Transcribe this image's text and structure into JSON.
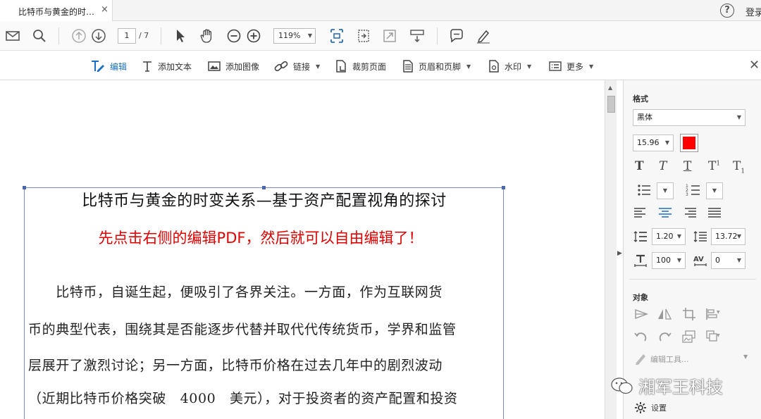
{
  "tab": {
    "title": "比特币与黄金的时…",
    "close": "×"
  },
  "header": {
    "help": "?",
    "login": "登录"
  },
  "toolbar": {
    "page_current": "1",
    "page_total": "/ 7",
    "zoom": "119%"
  },
  "edit_toolbar": {
    "items": [
      {
        "label": "编辑",
        "active": true
      },
      {
        "label": "添加文本"
      },
      {
        "label": "添加图像"
      },
      {
        "label": "链接"
      },
      {
        "label": "裁剪页面"
      },
      {
        "label": "页眉和页脚"
      },
      {
        "label": "水印"
      },
      {
        "label": "更多"
      }
    ],
    "close": "✕"
  },
  "document": {
    "title": "比特币与黄金的时变关系—基于资产配置视角的探讨",
    "instruction": "先点击右侧的编辑PDF，然后就可以自由编辑了！",
    "lines": [
      "　　比特币，自诞生起，便吸引了各界关注。一方面，作为互联网货",
      "币的典型代表，围绕其是否能逐步代替并取代代传统货币，学界和监管",
      "层展开了激烈讨论；另一方面，比特币价格在过去几年中的剧烈波动",
      "（近期比特币价格突破　4000　美元），对于投资者的资产配置和投资"
    ]
  },
  "panel": {
    "format_heading": "格式",
    "font_family": "黑体",
    "font_size": "15.96",
    "font_color": "#ff0000",
    "line_spacing": "1.20",
    "para_spacing": "13.72",
    "horiz_scale": "100",
    "char_spacing": "0",
    "object_heading": "对象",
    "edit_tool": "编辑工具...",
    "settings": "设置"
  },
  "watermark": "湘军王科技"
}
